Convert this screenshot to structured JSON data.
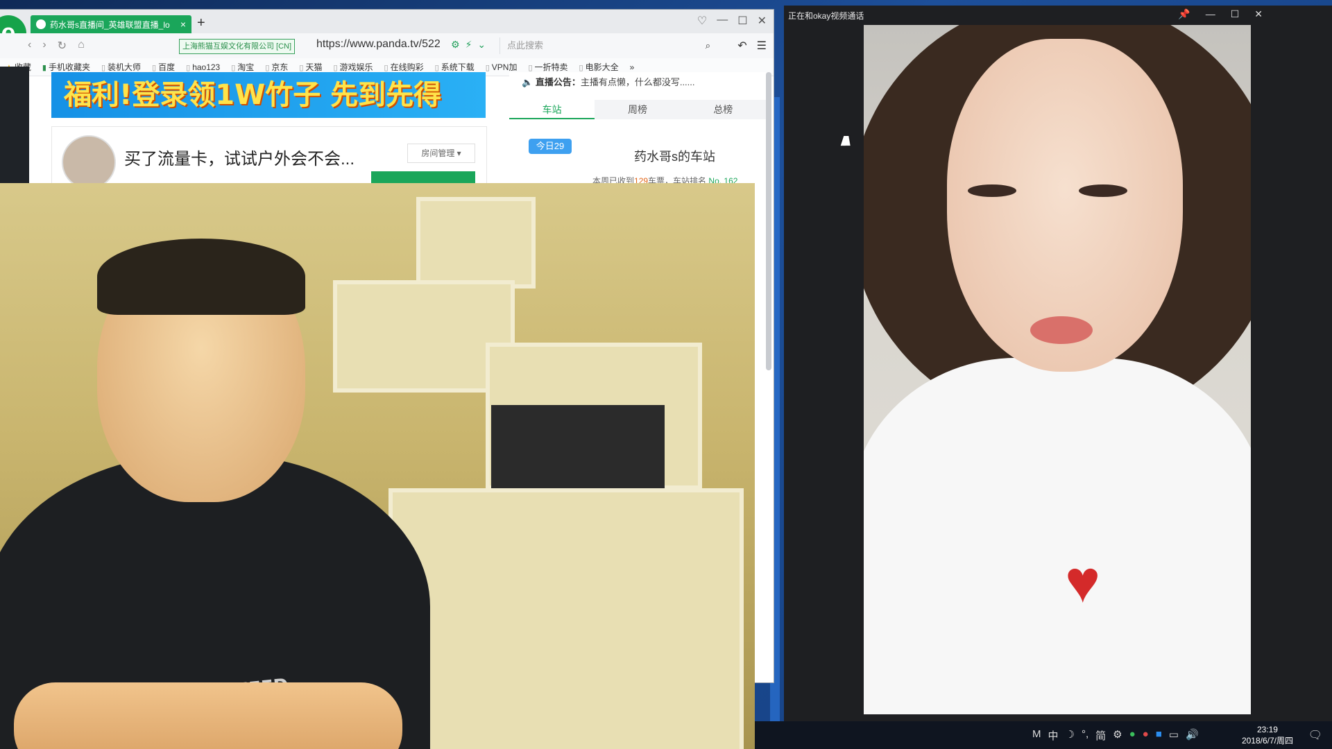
{
  "browser": {
    "tab_title": "药水哥s直播间_英雄联盟直播_lo",
    "new_tab": "+",
    "cert_label": "上海熊猫互娱文化有限公司 [CN]",
    "url": "https://www.panda.tv/522",
    "search_placeholder": "点此搜索",
    "bookmarks": [
      "收藏",
      "手机收藏夹",
      "装机大师",
      "百度",
      "hao123",
      "淘宝",
      "京东",
      "天猫",
      "游戏娱乐",
      "在线购彩",
      "系统下载",
      "VPN加",
      "一折特卖",
      "电影大全",
      "»"
    ]
  },
  "page": {
    "banner_text": "福利!登录领1W竹子 先到先得",
    "room_title": "买了流量卡，试试户外会不会...",
    "room_manage": "房间管理",
    "notice_label": "直播公告：",
    "notice_text": "主播有点懒，什么都没写......",
    "panel_tabs": [
      "车站",
      "周榜",
      "总榜"
    ],
    "today_badge": "今日29",
    "station_title": "药水哥s的车站",
    "station_sub_prefix": "本周已收到",
    "station_sub_count": "129",
    "station_sub_mid": "车票，车站排名",
    "station_sub_rank": "No. 162"
  },
  "webcam": {
    "shirt_print": "BOXING LIFED"
  },
  "call": {
    "title": "正在和okay视频通话"
  },
  "taskbar": {
    "tray_items": [
      "M",
      "中",
      "☽",
      "°,",
      "简",
      "⚙"
    ],
    "time": "23:19",
    "date": "2018/6/7/周四"
  },
  "colors": {
    "accent": "#1aa65a",
    "banner_blue": "#1591e6",
    "banner_text": "#ffe34a"
  }
}
